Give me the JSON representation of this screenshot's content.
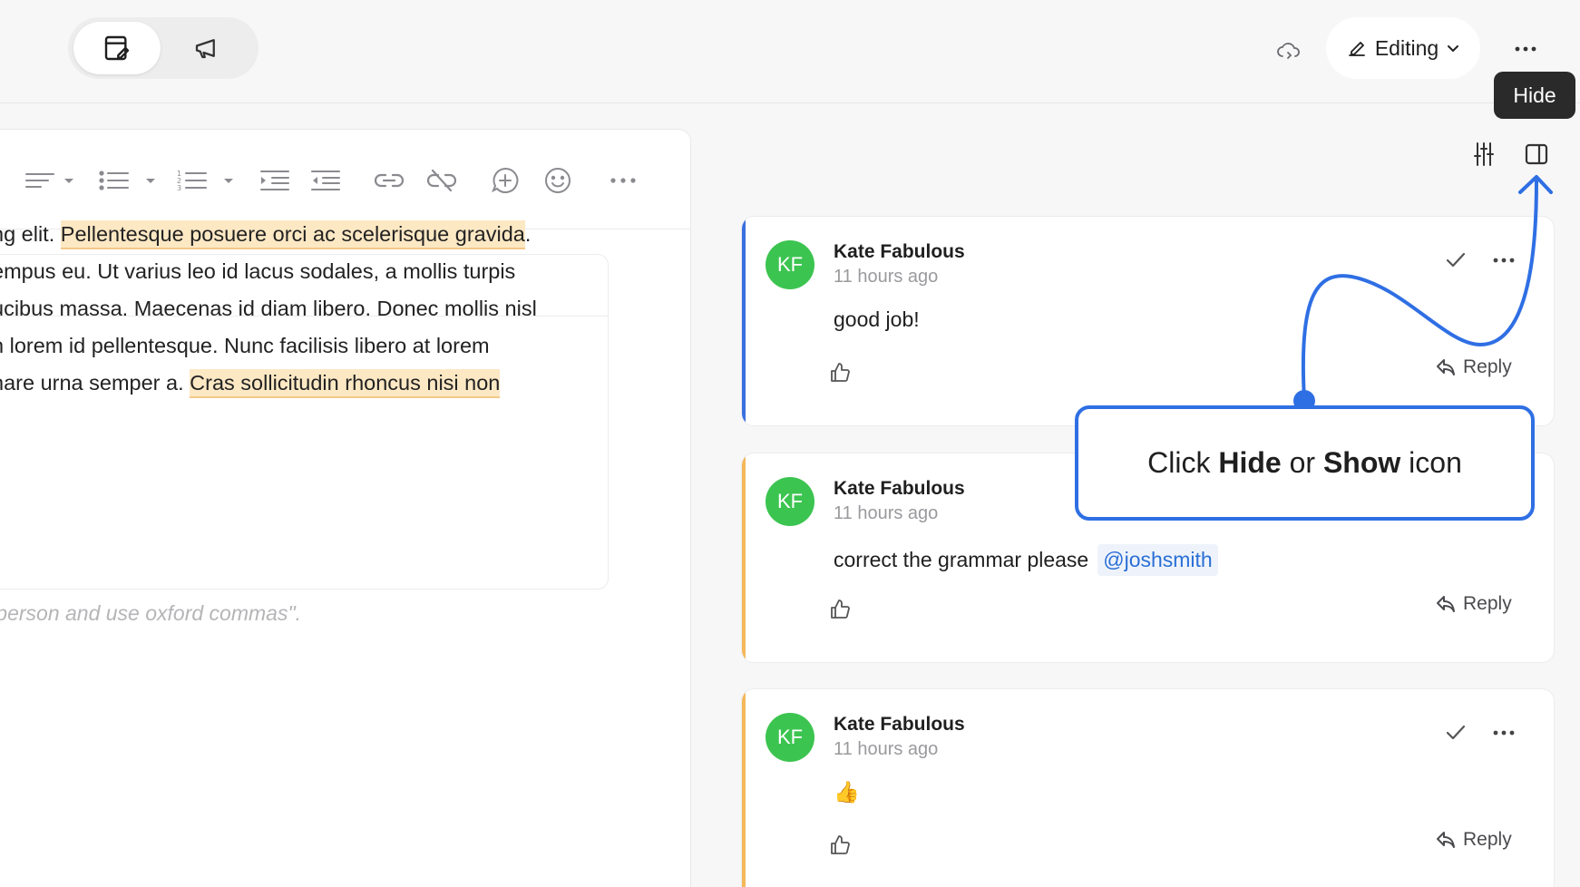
{
  "topbar": {
    "mode_switch": {
      "active": "editor-icon",
      "inactive": "megaphone-icon"
    },
    "cloud_icon": "cloud-sync-icon",
    "editing_label": "Editing",
    "more_icon": "more-icon"
  },
  "tooltip": {
    "text": "Hide"
  },
  "editor": {
    "toolbar_icons": [
      "align-icon",
      "bullet-list-icon",
      "numbered-list-icon",
      "indent-icon",
      "outdent-icon",
      "link-icon",
      "unlink-icon",
      "add-comment-icon",
      "emoji-icon",
      "more-icon"
    ],
    "text": {
      "line1_plain": "ng elit. ",
      "line1_highlight": "Pellentesque posuere orci ac scelerisque gravida",
      "line1_end": ".",
      "line2": "empus eu. Ut varius leo id lacus sodales, a mollis turpis",
      "line3": "ucibus massa. Maecenas id diam libero. Donec mollis nisl",
      "line4": "n lorem id pellentesque. Nunc facilisis libero at lorem",
      "line5_plain": "nare urna semper a. ",
      "line5_highlight": "Cras sollicitudin rhoncus nisi non"
    },
    "prompt_text": "st person and use oxford commas\"."
  },
  "comments": [
    {
      "initials": "KF",
      "author": "Kate Fabulous",
      "time": "11 hours ago",
      "body": "good job!",
      "mention": "",
      "reply_label": "Reply",
      "accent": "#3a6fe0"
    },
    {
      "initials": "KF",
      "author": "Kate Fabulous",
      "time": "11 hours ago",
      "body": "correct the grammar please",
      "mention": "@joshsmith",
      "reply_label": "Reply",
      "accent": "#f4b85a"
    },
    {
      "initials": "KF",
      "author": "Kate Fabulous",
      "time": "11 hours ago",
      "body": "👍",
      "mention": "",
      "reply_label": "Reply",
      "accent": "#f4b85a"
    }
  ],
  "callout": {
    "pre": "Click ",
    "b1": "Hide",
    "mid": " or ",
    "b2": "Show",
    "post": " icon"
  },
  "colors": {
    "accent_blue": "#2f6fe4",
    "avatar_green": "#3cc450",
    "highlight": "#fde8c4",
    "orange_bar": "#f4b85a"
  }
}
